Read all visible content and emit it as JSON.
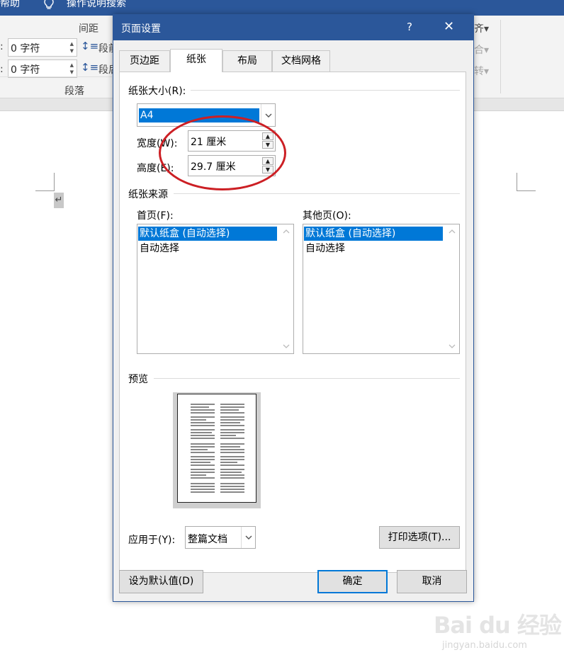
{
  "background": {
    "titlebar": {
      "help": "帮助",
      "search": "操作说明搜索"
    },
    "ribbon": {
      "spacing_label": "间距",
      "group_label": "段落",
      "before_label": "段前",
      "after_label": "段后",
      "spin_before": "0 字符",
      "spin_after": "0 字符",
      "right_text_1": "齐",
      "right_text_2": "合",
      "right_text_3": "转"
    },
    "para_mark": "↵"
  },
  "dialog": {
    "title": "页面设置",
    "help": "?",
    "close": "✕",
    "tabs": [
      "页边距",
      "纸张",
      "布局",
      "文档网格"
    ],
    "active_tab": "纸张",
    "paper_size_label": "纸张大小(R):",
    "paper_size_value": "A4",
    "width_label": "宽度(W):",
    "width_value": "21 厘米",
    "height_label": "高度(E):",
    "height_value": "29.7 厘米",
    "paper_source_label": "纸张来源",
    "first_page_label": "首页(F):",
    "other_pages_label": "其他页(O):",
    "first_page_items": [
      "默认纸盒 (自动选择)",
      "自动选择"
    ],
    "other_pages_items": [
      "默认纸盒 (自动选择)",
      "自动选择"
    ],
    "preview_label": "预览",
    "apply_to_label": "应用于(Y):",
    "apply_to_value": "整篇文档",
    "print_options": "打印选项(T)...",
    "set_default": "设为默认值(D)",
    "ok": "确定",
    "cancel": "取消"
  },
  "watermark": {
    "brand": "Bai du 经验",
    "url": "jingyan.baidu.com"
  },
  "colors": {
    "title_blue": "#2b579a",
    "selection": "#0078d7",
    "annotation_red": "#cc1f24"
  }
}
